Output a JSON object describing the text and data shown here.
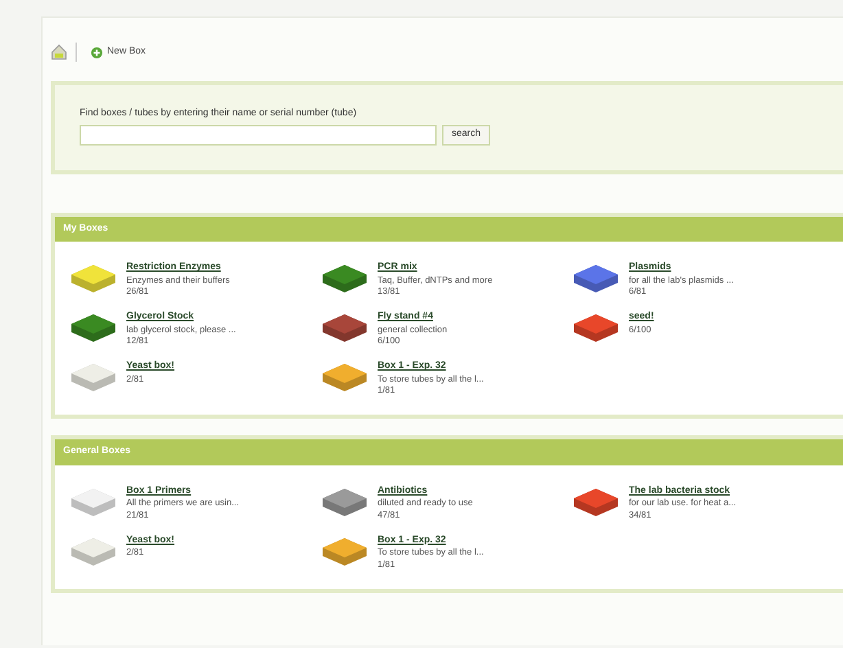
{
  "toolbar": {
    "new_box": "New Box"
  },
  "search": {
    "label": "Find boxes / tubes by entering their name or serial number (tube)",
    "button": "search"
  },
  "sections": [
    {
      "title": "My Boxes",
      "boxes": [
        {
          "name": "Restriction Enzymes",
          "description": "Enzymes and their buffers",
          "count": "26/81",
          "color": "#f0e33a"
        },
        {
          "name": "PCR mix",
          "description": "Taq, Buffer, dNTPs and more",
          "count": "13/81",
          "color": "#3a8a22"
        },
        {
          "name": "Plasmids",
          "description": "for all the lab's plasmids ...",
          "count": "6/81",
          "color": "#5b74e8"
        },
        {
          "name": "Glycerol Stock",
          "description": "lab glycerol stock, please ...",
          "count": "12/81",
          "color": "#3a8a22"
        },
        {
          "name": "Fly stand #4",
          "description": "general collection",
          "count": "6/100",
          "color": "#a8463a"
        },
        {
          "name": "seed!",
          "count": "6/100",
          "color": "#e8472a"
        },
        {
          "name": "Yeast box!",
          "count": "2/81",
          "color": "#eeeee6"
        },
        {
          "name": "Box 1 - Exp. 32",
          "description": "To store tubes by all the l...",
          "count": "1/81",
          "color": "#f0ae2e"
        }
      ]
    },
    {
      "title": "General Boxes",
      "boxes": [
        {
          "name": "Box 1 Primers",
          "description": "All the primers we are usin...",
          "count": "21/81",
          "color": "#f2f2f2"
        },
        {
          "name": "Antibiotics",
          "description": "diluted and ready to use",
          "count": "47/81",
          "color": "#9a9a9a"
        },
        {
          "name": "The lab bacteria stock",
          "description": "for our lab use. for heat a...",
          "count": "34/81",
          "color": "#e8472a"
        },
        {
          "name": "Yeast box!",
          "count": "2/81",
          "color": "#eeeee6"
        },
        {
          "name": "Box 1 - Exp. 32",
          "description": "To store tubes by all the l...",
          "count": "1/81",
          "color": "#f0ae2e"
        }
      ]
    }
  ]
}
